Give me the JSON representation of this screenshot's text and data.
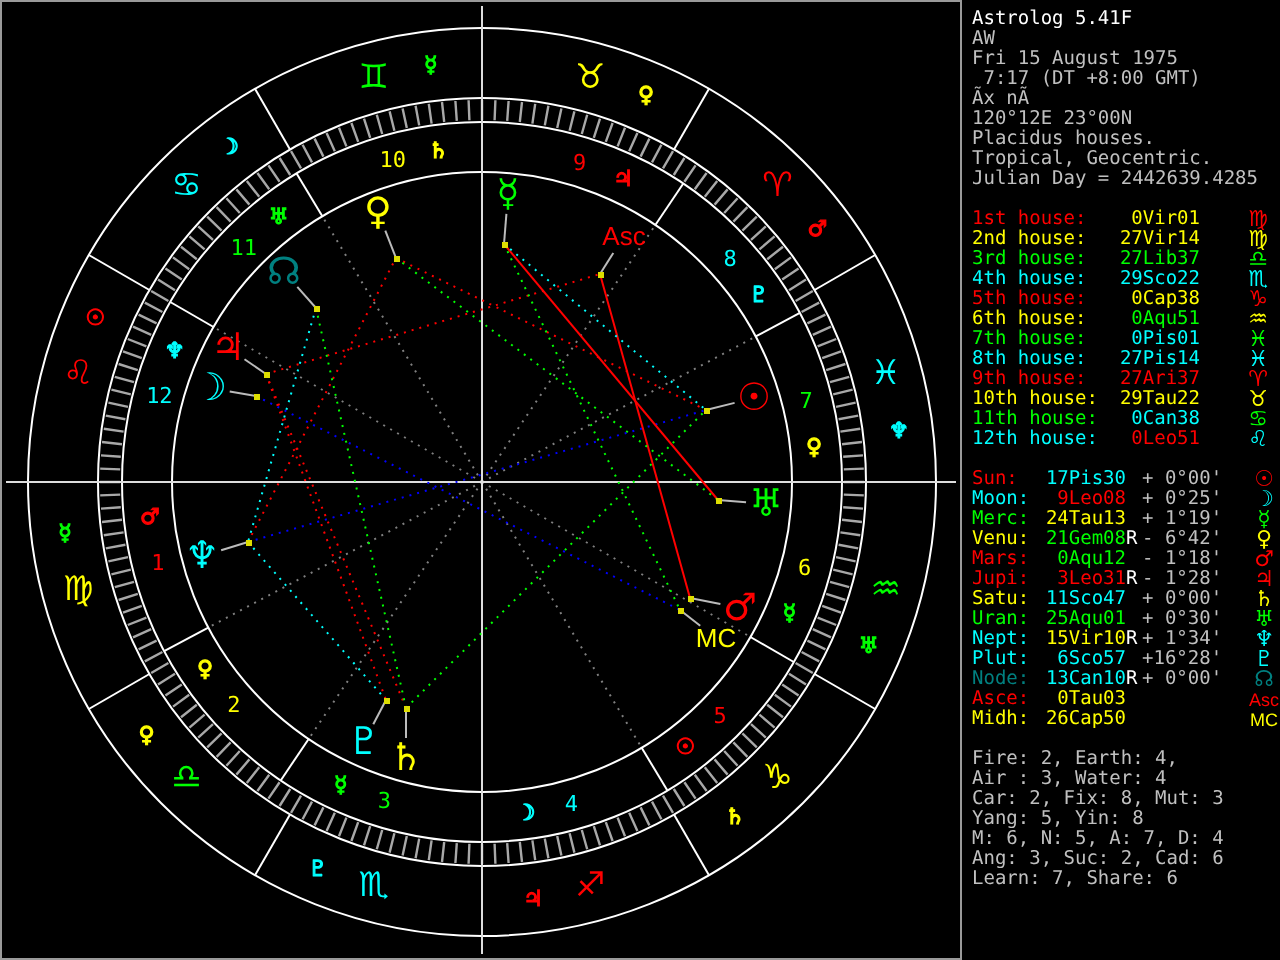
{
  "chart": {
    "signs": [
      {
        "glyph": "♊",
        "color": "#00ff00"
      },
      {
        "glyph": "♉",
        "color": "#ffff00"
      },
      {
        "glyph": "♈",
        "color": "#ff0000"
      },
      {
        "glyph": "♓",
        "color": "#00ffff"
      },
      {
        "glyph": "♒",
        "color": "#00ff00"
      },
      {
        "glyph": "♑",
        "color": "#ffff00"
      },
      {
        "glyph": "♐",
        "color": "#ff0000"
      },
      {
        "glyph": "♏",
        "color": "#00ffff"
      },
      {
        "glyph": "♎",
        "color": "#00ff00"
      },
      {
        "glyph": "♍",
        "color": "#ffff00"
      },
      {
        "glyph": "♌",
        "color": "#ff0000"
      },
      {
        "glyph": "♋",
        "color": "#00ffff"
      }
    ],
    "sign_rulers": [
      {
        "glyph": "☿",
        "color": "#00ff00"
      },
      {
        "glyph": "♀",
        "color": "#ffff00"
      },
      {
        "glyph": "♂",
        "color": "#ff0000"
      },
      {
        "glyph": "♆",
        "color": "#00ffff"
      },
      {
        "glyph": "♅",
        "color": "#00ff00"
      },
      {
        "glyph": "♄",
        "color": "#ffff00"
      },
      {
        "glyph": "♃",
        "color": "#ff0000"
      },
      {
        "glyph": "♇",
        "color": "#00ffff"
      },
      {
        "glyph": "♀",
        "color": "#ffff00"
      },
      {
        "glyph": "☿",
        "color": "#00ff00"
      },
      {
        "glyph": "☉",
        "color": "#ff0000"
      },
      {
        "glyph": "☽",
        "color": "#00ffff"
      }
    ],
    "houses": [
      {
        "number": "10",
        "color": "#ffff00"
      },
      {
        "number": "9",
        "color": "#ff0000"
      },
      {
        "number": "8",
        "color": "#00ffff"
      },
      {
        "number": "7",
        "color": "#00ff00"
      },
      {
        "number": "6",
        "color": "#ffff00"
      },
      {
        "number": "5",
        "color": "#ff0000"
      },
      {
        "number": "4",
        "color": "#00ffff"
      },
      {
        "number": "3",
        "color": "#00ff00"
      },
      {
        "number": "2",
        "color": "#ffff00"
      },
      {
        "number": "1",
        "color": "#ff0000"
      },
      {
        "number": "12",
        "color": "#00ffff"
      },
      {
        "number": "11",
        "color": "#00ff00"
      }
    ],
    "house_rulers": [
      {
        "glyph": "♄",
        "color": "#ffff00"
      },
      {
        "glyph": "♃",
        "color": "#ff0000"
      },
      {
        "glyph": "♇",
        "color": "#00ffff"
      },
      {
        "glyph": "♀",
        "color": "#ffff00"
      },
      {
        "glyph": "☿",
        "color": "#00ff00"
      },
      {
        "glyph": "☉",
        "color": "#ff0000"
      },
      {
        "glyph": "☽",
        "color": "#00ffff"
      },
      {
        "glyph": "☿",
        "color": "#00ff00"
      },
      {
        "glyph": "♀",
        "color": "#ffff00"
      },
      {
        "glyph": "♂",
        "color": "#ff0000"
      },
      {
        "glyph": "♆",
        "color": "#00ffff"
      },
      {
        "glyph": "♅",
        "color": "#00ff00"
      }
    ],
    "planets": [
      {
        "glyph": "☿",
        "color": "#00ff00"
      },
      {
        "glyph": "♀",
        "color": "#ffff00"
      },
      {
        "glyph": "Asc",
        "color": "#ff0000"
      },
      {
        "glyph": "☊",
        "color": "#008080"
      },
      {
        "glyph": "♃",
        "color": "#ff0000"
      },
      {
        "glyph": "☽",
        "color": "#00ffff"
      },
      {
        "glyph": "☉",
        "color": "#ff0000"
      },
      {
        "glyph": "♅",
        "color": "#00ff00"
      },
      {
        "glyph": "♆",
        "color": "#00ffff"
      },
      {
        "glyph": "♂",
        "color": "#ff0000"
      },
      {
        "glyph": "MC",
        "color": "#ffff00"
      },
      {
        "glyph": "♇",
        "color": "#00ffff"
      },
      {
        "glyph": "♄",
        "color": "#ffff00"
      }
    ]
  },
  "info": {
    "title": "Astrolog 5.41F",
    "lines": [
      "AW",
      "Fri 15 August 1975",
      " 7:17 (DT +8:00 GMT)",
      "Ãx nÃ",
      "120°12E 23°00N",
      "Placidus houses.",
      "Tropical, Geocentric.",
      "Julian Day = 2442639.4285"
    ]
  },
  "house_cusps": [
    {
      "label": "1st house:",
      "position": {
        "text": "0Vir01",
        "color": "#ffff00"
      },
      "glyph": "♍",
      "color": "#ff0000"
    },
    {
      "label": "2nd house:",
      "position": {
        "text": "27Vir14",
        "color": "#ffff00"
      },
      "glyph": "♍",
      "color": "#ffff00"
    },
    {
      "label": "3rd house:",
      "position": {
        "text": "27Lib37",
        "color": "#00ff00"
      },
      "glyph": "♎",
      "color": "#00ff00"
    },
    {
      "label": "4th house:",
      "position": {
        "text": "29Sco22",
        "color": "#00ffff"
      },
      "glyph": "♏",
      "color": "#00ffff"
    },
    {
      "label": "5th house:",
      "position": {
        "text": "0Cap38",
        "color": "#ffff00"
      },
      "glyph": "♑",
      "color": "#ff0000"
    },
    {
      "label": "6th house:",
      "position": {
        "text": "0Aqu51",
        "color": "#00ff00"
      },
      "glyph": "♒",
      "color": "#ffff00"
    },
    {
      "label": "7th house:",
      "position": {
        "text": "0Pis01",
        "color": "#00ffff"
      },
      "glyph": "♓",
      "color": "#00ff00"
    },
    {
      "label": "8th house:",
      "position": {
        "text": "27Pis14",
        "color": "#00ffff"
      },
      "glyph": "♓",
      "color": "#00ffff"
    },
    {
      "label": "9th house:",
      "position": {
        "text": "27Ari37",
        "color": "#ff0000"
      },
      "glyph": "♈",
      "color": "#ff0000"
    },
    {
      "label": "10th house:",
      "position": {
        "text": "29Tau22",
        "color": "#ffff00"
      },
      "glyph": "♉",
      "color": "#ffff00"
    },
    {
      "label": "11th house:",
      "position": {
        "text": "0Can38",
        "color": "#00ffff"
      },
      "glyph": "♋",
      "color": "#00ff00"
    },
    {
      "label": "12th house:",
      "position": {
        "text": "0Leo51",
        "color": "#ff0000"
      },
      "glyph": "♌",
      "color": "#00ffff"
    }
  ],
  "positions": [
    {
      "label": "Sun:",
      "position": {
        "text": "17Pis30",
        "color": "#00ffff"
      },
      "motion": "+ 0°00'",
      "glyph": "☉",
      "color": "#ff0000"
    },
    {
      "label": "Moon:",
      "position": {
        "text": "9Leo08",
        "color": "#ff0000"
      },
      "motion": "+ 0°25'",
      "glyph": "☽",
      "color": "#00ffff"
    },
    {
      "label": "Merc:",
      "position": {
        "text": "24Tau13",
        "color": "#ffff00"
      },
      "motion": "+ 1°19'",
      "glyph": "☿",
      "color": "#00ff00"
    },
    {
      "label": "Venu:",
      "position": {
        "text": "21Gem08",
        "color": "#00ff00"
      },
      "retro": "R",
      "motion": "- 6°42'",
      "glyph": "♀",
      "color": "#ffff00"
    },
    {
      "label": "Mars:",
      "position": {
        "text": "0Aqu12",
        "color": "#00ff00"
      },
      "motion": "- 1°18'",
      "glyph": "♂",
      "color": "#ff0000"
    },
    {
      "label": "Jupi:",
      "position": {
        "text": "3Leo31",
        "color": "#ff0000"
      },
      "retro": "R",
      "motion": "- 1°28'",
      "glyph": "♃",
      "color": "#ff0000"
    },
    {
      "label": "Satu:",
      "position": {
        "text": "11Sco47",
        "color": "#00ffff"
      },
      "motion": "+ 0°00'",
      "glyph": "♄",
      "color": "#ffff00"
    },
    {
      "label": "Uran:",
      "position": {
        "text": "25Aqu01",
        "color": "#00ff00"
      },
      "motion": "+ 0°30'",
      "glyph": "♅",
      "color": "#00ff00"
    },
    {
      "label": "Nept:",
      "position": {
        "text": "15Vir10",
        "color": "#ffff00"
      },
      "retro": "R",
      "motion": "+ 1°34'",
      "glyph": "♆",
      "color": "#00ffff"
    },
    {
      "label": "Plut:",
      "position": {
        "text": "6Sco57",
        "color": "#00ffff"
      },
      "motion": "+16°28'",
      "glyph": "♇",
      "color": "#00ffff"
    },
    {
      "label": "Node:",
      "position": {
        "text": "13Can10",
        "color": "#00ffff"
      },
      "retro": "R",
      "motion": "+ 0°00'",
      "glyph": "☊",
      "color": "#008080"
    },
    {
      "label": "Asce:",
      "position": {
        "text": "0Tau03",
        "color": "#ffff00"
      },
      "glyph": "Asc",
      "color": "#ff0000"
    },
    {
      "label": "Midh:",
      "position": {
        "text": "26Cap50",
        "color": "#ffff00"
      },
      "glyph": "MC",
      "color": "#ffff00"
    }
  ],
  "elements": [
    "Fire: 2, Earth: 4,",
    "Air : 3, Water: 4",
    "Car: 2, Fix: 8, Mut: 3",
    "Yang: 5, Yin: 8",
    "M: 6, N: 5, A: 7, D: 4",
    "Ang: 3, Suc: 2, Cad: 6",
    "Learn: 7, Share: 6"
  ]
}
